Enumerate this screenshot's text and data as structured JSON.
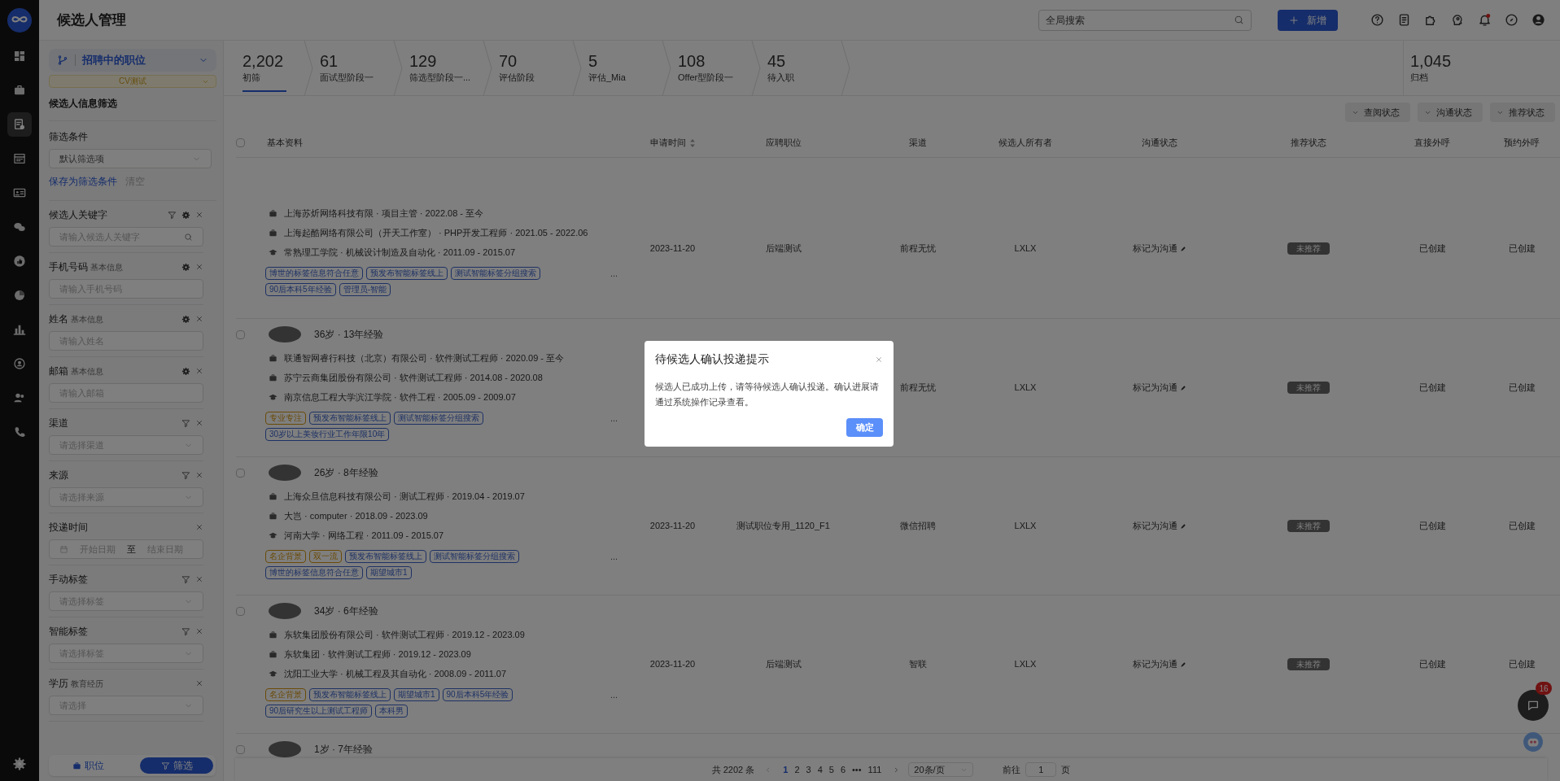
{
  "nav": [
    {
      "selected": false
    },
    {
      "selected": false
    },
    {
      "selected": true
    },
    {
      "selected": false
    },
    {
      "selected": false
    },
    {
      "selected": false
    },
    {
      "selected": false
    },
    {
      "selected": false
    },
    {
      "selected": false
    },
    {
      "selected": false
    },
    {
      "selected": false
    },
    {
      "selected": false
    }
  ],
  "header": {
    "title": "候选人管理",
    "search": {
      "placeholder": "全局搜索"
    },
    "add_button": "新增",
    "unread": true
  },
  "filter_panel": {
    "job_selector": {
      "label": "招聘中的职位",
      "sub": "CV测试"
    },
    "heading": "候选人信息筛选",
    "conditions": {
      "label": "筛选条件",
      "select": "默认筛选项",
      "save_link": "保存为筛选条件",
      "clear_link": "清空"
    },
    "filters": [
      {
        "label": "候选人关键字",
        "funnel": true,
        "gear": true,
        "kind": "search",
        "placeholder": "请输入候选人关键字"
      },
      {
        "label": "手机号码",
        "sub": "基本信息",
        "funnel": false,
        "gear": true,
        "kind": "text",
        "placeholder": "请输入手机号码"
      },
      {
        "label": "姓名",
        "sub": "基本信息",
        "funnel": false,
        "gear": true,
        "kind": "text",
        "placeholder": "请输入姓名"
      },
      {
        "label": "邮箱",
        "sub": "基本信息",
        "funnel": false,
        "gear": true,
        "kind": "text",
        "placeholder": "请输入邮箱"
      },
      {
        "label": "渠道",
        "funnel": true,
        "gear": false,
        "kind": "select",
        "placeholder": "请选择渠道"
      },
      {
        "label": "来源",
        "funnel": true,
        "gear": false,
        "kind": "select",
        "placeholder": "请选择来源"
      },
      {
        "label": "投递时间",
        "funnel": false,
        "gear": false,
        "kind": "daterange",
        "start": "开始日期",
        "separator": "至",
        "end": "结束日期"
      },
      {
        "label": "手动标签",
        "funnel": true,
        "gear": false,
        "kind": "select",
        "placeholder": "请选择标签"
      },
      {
        "label": "智能标签",
        "funnel": true,
        "gear": false,
        "kind": "select",
        "placeholder": "请选择标签"
      },
      {
        "label": "学历",
        "sub": "教育经历",
        "funnel": false,
        "gear": false,
        "kind": "select",
        "placeholder": "请选择"
      }
    ],
    "bottom_tabs": [
      {
        "label": "职位",
        "selected": false
      },
      {
        "label": "筛选",
        "selected": true
      }
    ]
  },
  "stages": [
    {
      "count": "2,202",
      "label": "初筛",
      "selected": true
    },
    {
      "count": "61",
      "label": "面试型阶段一",
      "selected": false
    },
    {
      "count": "129",
      "label": "筛选型阶段一...",
      "selected": false
    },
    {
      "count": "70",
      "label": "评估阶段",
      "selected": false
    },
    {
      "count": "5",
      "label": "评估_Mia",
      "selected": false
    },
    {
      "count": "108",
      "label": "Offer型阶段一",
      "selected": false
    },
    {
      "count": "45",
      "label": "待入职",
      "selected": false
    }
  ],
  "archive": {
    "count": "1,045",
    "label": "归档"
  },
  "status_filters": [
    "查阅状态",
    "沟通状态",
    "推荐状态"
  ],
  "table": {
    "all_checked": false,
    "columns": [
      {
        "label": "基本资料",
        "sortable": false
      },
      {
        "label": "申请时间",
        "sortable": true
      },
      {
        "label": "应聘职位",
        "sortable": false
      },
      {
        "label": "渠道",
        "sortable": false
      },
      {
        "label": "候选人所有者",
        "sortable": false
      },
      {
        "label": "沟通状态",
        "sortable": false
      },
      {
        "label": "推荐状态",
        "sortable": false
      },
      {
        "label": "直接外呼",
        "sortable": false
      },
      {
        "label": "预约外呼",
        "sortable": false
      }
    ],
    "rows": [
      {
        "experience": [
          {
            "kind": "work",
            "text": "上海苏炘网络科技有限 · 项目主管 · 2022.08 - 至今"
          },
          {
            "kind": "work",
            "text": "上海起酷网络有限公司（开天工作室） · PHP开发工程师 · 2021.05 - 2022.06"
          },
          {
            "kind": "education",
            "text": "常熟理工学院 · 机械设计制造及自动化 · 2011.09 - 2015.07"
          }
        ],
        "tags": [
          {
            "text": "博世的标签信息符合任意",
            "kind": "smart"
          },
          {
            "text": "预发布智能标签线上",
            "kind": "smart"
          },
          {
            "text": "测试智能标签分组搜索",
            "kind": "smart"
          },
          {
            "text": "90后本科5年经验",
            "kind": "smart"
          },
          {
            "text": "管理员-智能",
            "kind": "smart"
          }
        ],
        "more": "...",
        "date": "2023-11-20",
        "position": "后端测试",
        "channel": "前程无忧",
        "owner": "LXLX",
        "communication": "标记为沟通",
        "recommend": "未推荐",
        "direct_call": "已创建",
        "scheduled_call": "已创建"
      },
      {
        "checked": false,
        "summary": "36岁 · 13年经验",
        "experience": [
          {
            "kind": "work",
            "text": "联通智网睿行科技（北京）有限公司 · 软件测试工程师 · 2020.09 - 至今"
          },
          {
            "kind": "work",
            "text": "苏宁云商集团股份有限公司 · 软件测试工程师 · 2014.08 - 2020.08"
          },
          {
            "kind": "education",
            "text": "南京信息工程大学滨江学院 · 软件工程 · 2005.09 - 2009.07"
          }
        ],
        "tags": [
          {
            "text": "专业专注",
            "kind": "highlight"
          },
          {
            "text": "预发布智能标签线上",
            "kind": "smart"
          },
          {
            "text": "测试智能标签分组搜索",
            "kind": "smart"
          },
          {
            "text": "30岁以上美妆行业工作年限10年",
            "kind": "smart"
          }
        ],
        "more": "...",
        "channel": "前程无忧",
        "owner": "LXLX",
        "communication": "标记为沟通",
        "recommend": "未推荐",
        "direct_call": "已创建",
        "scheduled_call": "已创建"
      },
      {
        "checked": false,
        "summary": "26岁 · 8年经验",
        "experience": [
          {
            "kind": "work",
            "text": "上海众旦信息科技有限公司 · 测试工程师 · 2019.04 - 2019.07"
          },
          {
            "kind": "work",
            "text": "大岂 · computer · 2018.09 - 2023.09"
          },
          {
            "kind": "education",
            "text": "河南大学 · 网络工程 · 2011.09 - 2015.07"
          }
        ],
        "tags": [
          {
            "text": "名企背景",
            "kind": "highlight"
          },
          {
            "text": "双一流",
            "kind": "highlight"
          },
          {
            "text": "预发布智能标签线上",
            "kind": "smart"
          },
          {
            "text": "测试智能标签分组搜索",
            "kind": "smart"
          },
          {
            "text": "博世的标签信息符合任意",
            "kind": "smart"
          },
          {
            "text": "期望城市1",
            "kind": "smart"
          }
        ],
        "more": "...",
        "date": "2023-11-20",
        "position": "测试职位专用_1120_F1",
        "channel": "微信招聘",
        "owner": "LXLX",
        "communication": "标记为沟通",
        "recommend": "未推荐",
        "direct_call": "已创建",
        "scheduled_call": "已创建"
      },
      {
        "checked": false,
        "summary": "34岁 · 6年经验",
        "experience": [
          {
            "kind": "work",
            "text": "东软集团股份有限公司 · 软件测试工程师 · 2019.12 - 2023.09"
          },
          {
            "kind": "work",
            "text": "东软集团 · 软件测试工程师 · 2019.12 - 2023.09"
          },
          {
            "kind": "education",
            "text": "沈阳工业大学 · 机械工程及其自动化 · 2008.09 - 2011.07"
          }
        ],
        "tags": [
          {
            "text": "名企背景",
            "kind": "highlight"
          },
          {
            "text": "预发布智能标签线上",
            "kind": "smart"
          },
          {
            "text": "期望城市1",
            "kind": "smart"
          },
          {
            "text": "90后本科5年经验",
            "kind": "smart"
          },
          {
            "text": "90后研究生以上测试工程师",
            "kind": "smart"
          },
          {
            "text": "本科男",
            "kind": "smart"
          }
        ],
        "more": "...",
        "date": "2023-11-20",
        "position": "后端测试",
        "channel": "智联",
        "owner": "LXLX",
        "communication": "标记为沟通",
        "recommend": "未推荐",
        "direct_call": "已创建",
        "scheduled_call": "已创建"
      },
      {
        "checked": false,
        "summary": "1岁 · 7年经验"
      }
    ]
  },
  "pagination": {
    "total": "共 2202 条",
    "pages": [
      {
        "label": "1",
        "selected": true
      },
      {
        "label": "2",
        "selected": false
      },
      {
        "label": "3",
        "selected": false
      },
      {
        "label": "4",
        "selected": false
      },
      {
        "label": "5",
        "selected": false
      },
      {
        "label": "6",
        "selected": false
      },
      {
        "label": "•••",
        "selected": false
      },
      {
        "label": "111",
        "selected": false
      }
    ],
    "page_size": "20条/页",
    "goto_label": "前往",
    "goto_value": "1",
    "goto_suffix": "页"
  },
  "chat_badge": "16",
  "dialog": {
    "title": "待候选人确认投递提示",
    "body": "候选人已成功上传，请等待候选人确认投递。确认进展请通过系统操作记录查看。",
    "confirm": "确定"
  }
}
